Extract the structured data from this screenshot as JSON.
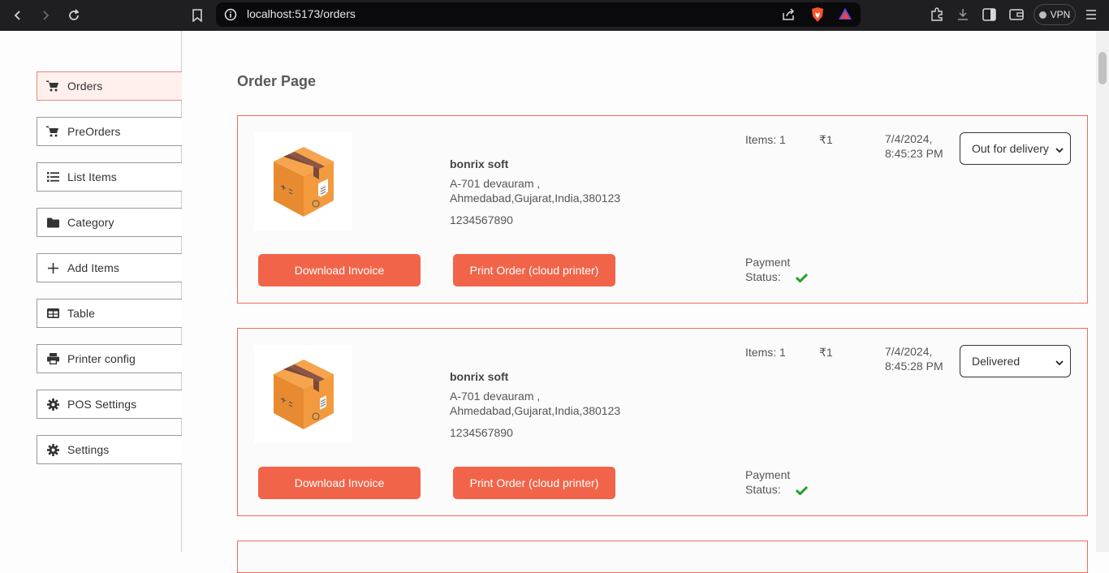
{
  "browser": {
    "url_host": "localhost",
    "url_rest": ":5173/orders",
    "vpn_label": "VPN"
  },
  "sidebar": {
    "items": [
      {
        "label": "Orders",
        "icon": "cart-icon"
      },
      {
        "label": "PreOrders",
        "icon": "cart-icon"
      },
      {
        "label": "List Items",
        "icon": "list-icon"
      },
      {
        "label": "Category",
        "icon": "folder-icon"
      },
      {
        "label": "Add Items",
        "icon": "plus-icon"
      },
      {
        "label": "Table",
        "icon": "table-icon"
      },
      {
        "label": "Printer config",
        "icon": "printer-icon"
      },
      {
        "label": "POS Settings",
        "icon": "gear-icon"
      },
      {
        "label": "Settings",
        "icon": "gear-icon"
      }
    ]
  },
  "main": {
    "title": "Order Page",
    "orders": [
      {
        "customer": "bonrix soft",
        "address": "A-701 devauram , Ahmedabad,Gujarat,India,380123",
        "phone": "1234567890",
        "items": "Items: 1",
        "price": "₹1",
        "date": "7/4/2024, 8:45:23 PM",
        "status": "Out for delivery",
        "invoice_label": "Download Invoice",
        "print_label": "Print Order (cloud printer)",
        "payment_label": "Payment Status:"
      },
      {
        "customer": "bonrix soft",
        "address": "A-701 devauram , Ahmedabad,Gujarat,India,380123",
        "phone": "1234567890",
        "items": "Items: 1",
        "price": "₹1",
        "date": "7/4/2024, 8:45:28 PM",
        "status": "Delivered",
        "invoice_label": "Download Invoice",
        "print_label": "Print Order (cloud printer)",
        "payment_label": "Payment Status:"
      }
    ]
  },
  "colors": {
    "accent": "#f26449",
    "card_border": "#ee6d5a",
    "check": "#22a02a"
  }
}
